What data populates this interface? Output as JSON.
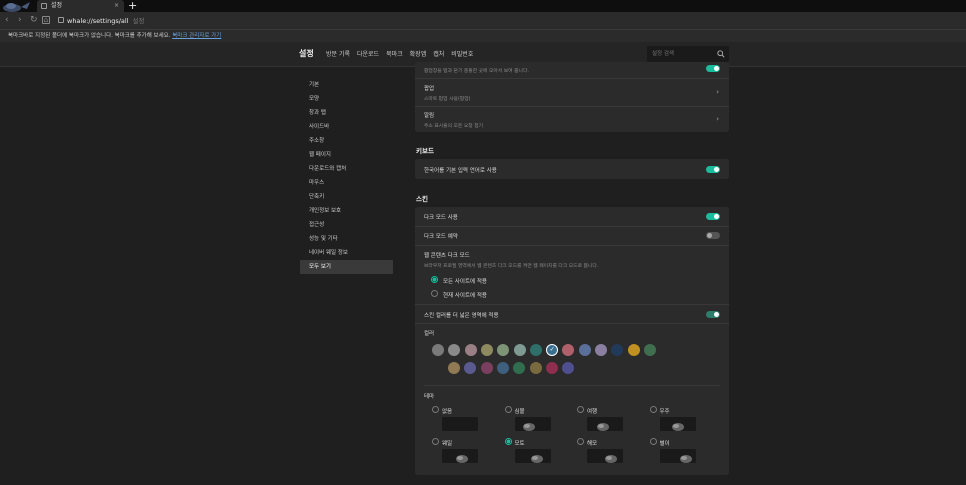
{
  "browser": {
    "tab_title": "설정",
    "tab_close": "×",
    "new_tab": "+",
    "url": "whale://settings/all",
    "url_suffix": "설정",
    "bookmark_notice": "북마크바로 지정된 폴더에 북마크가 없습니다. 북마크를 추가해 보세요.",
    "bookmark_link": "북마크 관리자로 가기"
  },
  "header": {
    "title": "설정",
    "nav": [
      "방문 기록",
      "다운로드",
      "북마크",
      "확장앱",
      "캡처",
      "비밀번호"
    ],
    "search_placeholder": "설정 검색"
  },
  "sidebar": {
    "items": [
      "기본",
      "모양",
      "창과 탭",
      "사이드바",
      "주소창",
      "웹 페이지",
      "다운로드와 캡처",
      "마우스",
      "단축키",
      "개인정보 보호",
      "접근성",
      "성능 및 기타",
      "네이버 웨일 정보",
      "모두 보기"
    ],
    "active_index": 13
  },
  "top_card": {
    "partial_text": "팝업창을 탭과 닫기 충돌한 곳에 모아서 보여 줍니다.",
    "partial_toggle": true,
    "rows": [
      {
        "title": "팝업",
        "sub": "스마트 팝업 사용(팝업)"
      },
      {
        "title": "알림",
        "sub": "주소 표시줄의 모든 요청 접기"
      }
    ]
  },
  "keyboard": {
    "title": "키보드",
    "row": "한국어를 기본 입력 언어로 사용",
    "enabled": true
  },
  "skin": {
    "title": "스킨",
    "dark_mode": {
      "label": "다크 모드 사용",
      "enabled": true
    },
    "dark_reserve": {
      "label": "다크 모드 예약",
      "enabled": false
    },
    "web_content": {
      "title": "웹 콘텐츠 다크 모드",
      "desc": "브라우저 프로필 영역에서 웹 콘텐츠 다크 모드를 켜면 웹 페이지를 다크 모드로 봅니다.",
      "options": [
        "모든 사이트에 적용",
        "현재 사이트에 적용"
      ],
      "selected": 0
    },
    "wide_skin": {
      "label": "스킨 컬러를 더 넓은 영역에 적용",
      "enabled": true
    },
    "color_label": "컬러",
    "colors_row1": [
      "#7a7a7a",
      "#8a8a8a",
      "#9a7f86",
      "#8c8a5e",
      "#7e9477",
      "#7f9a92",
      "#2e6f6a",
      "#3a6f90",
      "#b0606a",
      "#5a6f9a",
      "#8a7fa0",
      "#223a5a",
      "#c09020",
      "#3f6f4f"
    ],
    "colors_row2": [
      "#8f7a55",
      "#5a5a8f",
      "#7a3f5f",
      "#3f5f7f",
      "#2f6f4f",
      "#7a6a3f",
      "#8f2f4f",
      "#4f4f8f"
    ],
    "theme_label": "테마",
    "themes": [
      "없음",
      "심볼",
      "여행",
      "우주",
      "웨일",
      "모토",
      "해모",
      "별이"
    ],
    "theme_selected": 5
  },
  "colors": {
    "accent": "#1abc9c",
    "background": "#1f1f1f",
    "card": "#2b2b2b"
  }
}
